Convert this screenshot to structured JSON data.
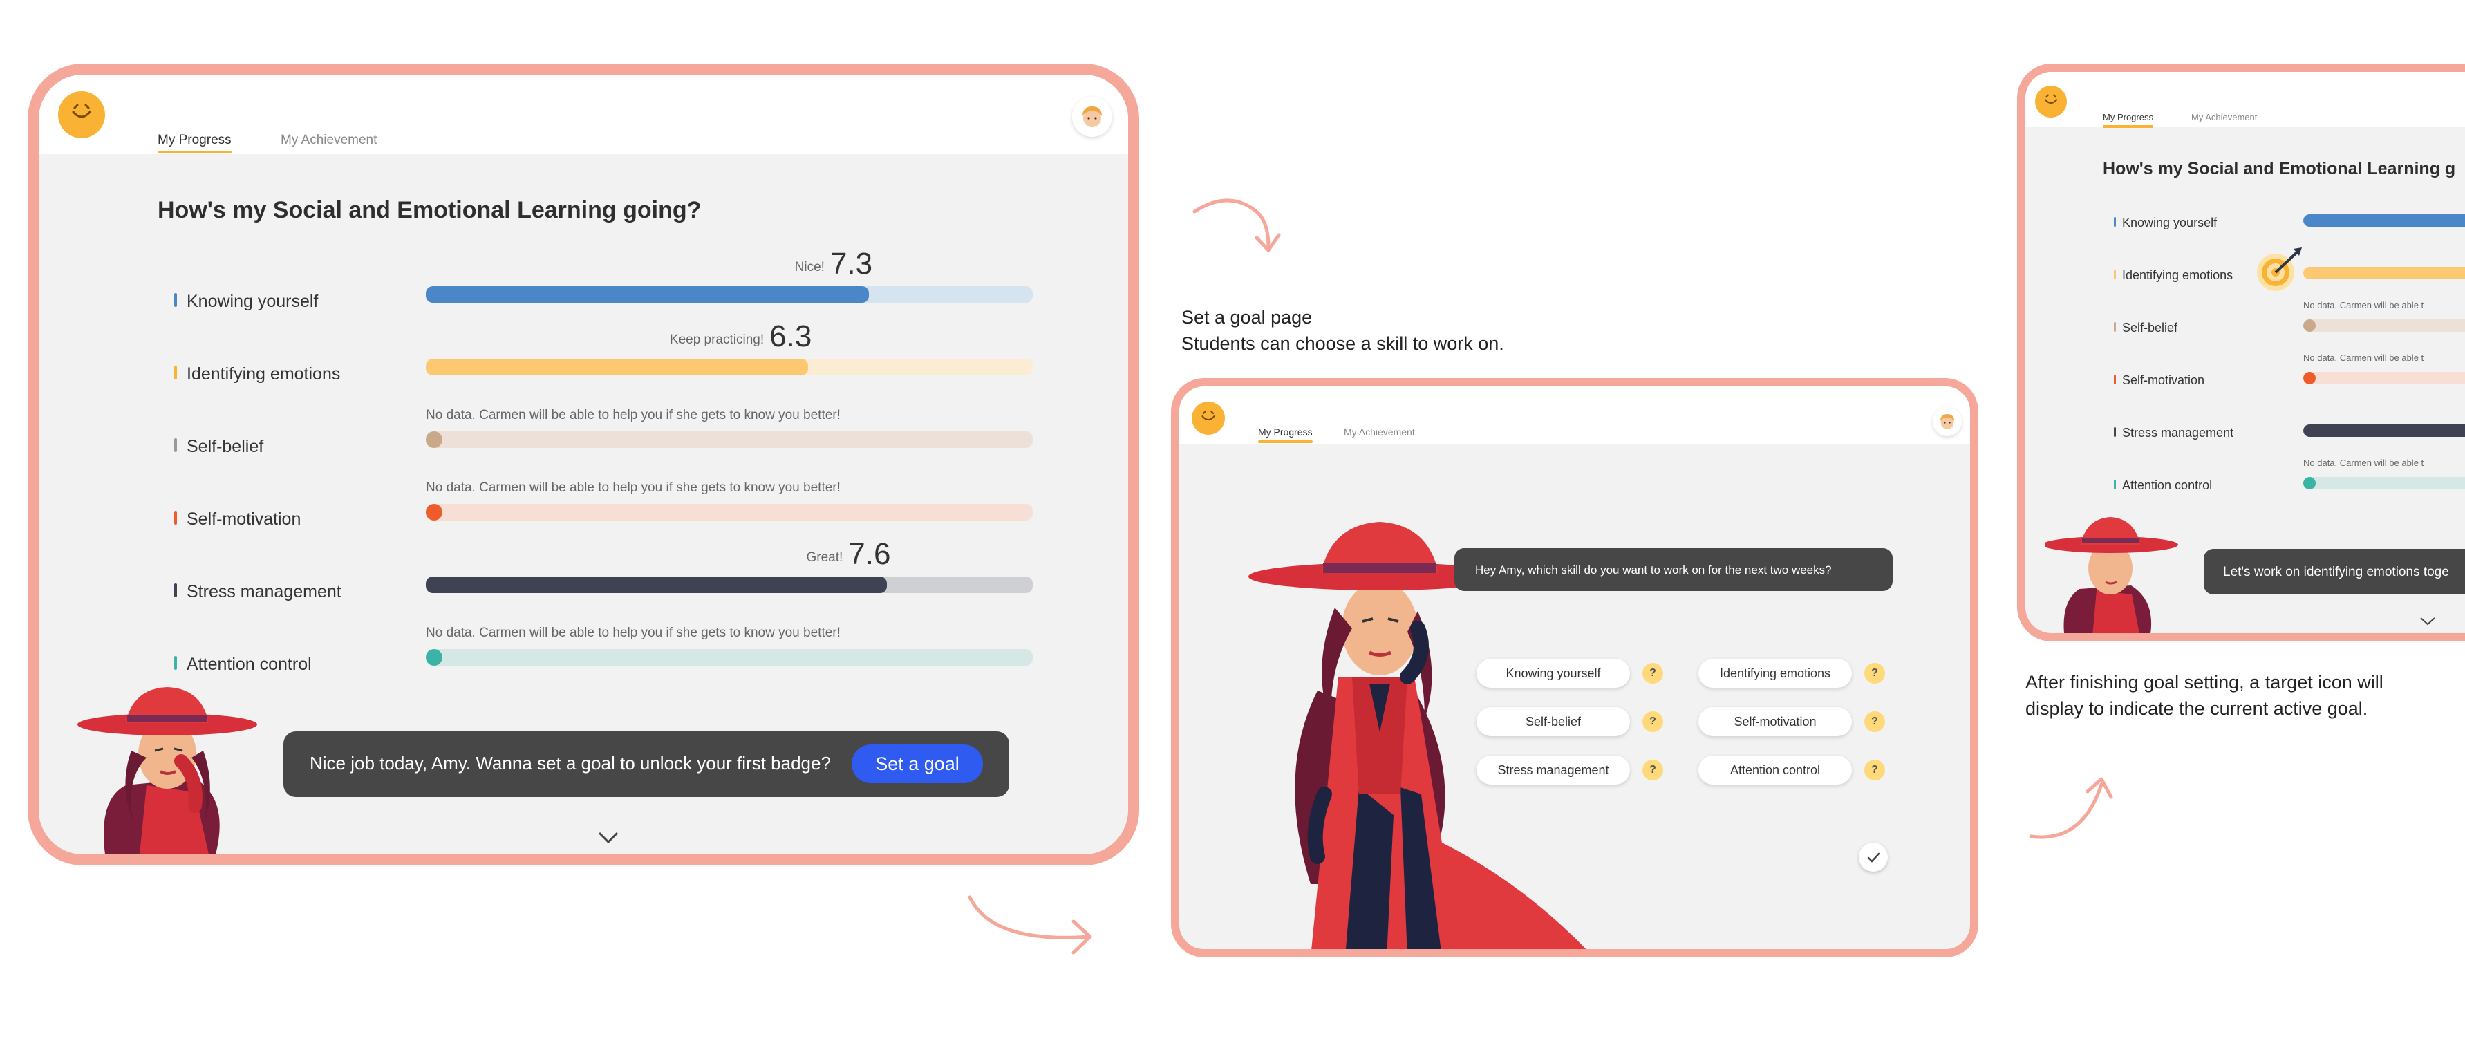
{
  "colors": {
    "frame_border": "#f5a79a",
    "primary_blue": "#2f5bf0",
    "brand_yellow": "#f9b233",
    "dark_bubble": "#474747"
  },
  "screen1": {
    "tabs": [
      "My Progress",
      "My Achievement"
    ],
    "active_tab": "My Progress",
    "title": "How's my Social and Emotional Learning going?",
    "skills": [
      {
        "label": "Knowing yourself",
        "word": "Nice!",
        "score": "7.3",
        "value": 7.3,
        "nodata": "",
        "color": "#4a86c8",
        "track": "#d6e4ef",
        "marker": "#4a86c8"
      },
      {
        "label": "Identifying emotions",
        "word": "Keep practicing!",
        "score": "6.3",
        "value": 6.3,
        "nodata": "",
        "color": "#fdc872",
        "track": "#fbecd3",
        "marker": "#f9b233"
      },
      {
        "label": "Self-belief",
        "word": "",
        "score": "",
        "value": null,
        "nodata": "No data. Carmen will be able to help you if she gets to know you better!",
        "color": "#c9a98a",
        "track": "#ede0d8",
        "marker": "#999"
      },
      {
        "label": "Self-motivation",
        "word": "",
        "score": "",
        "value": null,
        "nodata": "No data. Carmen will be able to help you if she gets to know you better!",
        "color": "#ef5c2b",
        "track": "#f7dfd6",
        "marker": "#ef5c2b"
      },
      {
        "label": "Stress management",
        "word": "Great!",
        "score": "7.6",
        "value": 7.6,
        "nodata": "",
        "color": "#3e4252",
        "track": "#cfd0d4",
        "marker": "#3e4252"
      },
      {
        "label": "Attention control",
        "word": "",
        "score": "",
        "value": null,
        "nodata": "No data. Carmen will be able to help you if she gets to know you better!",
        "color": "#3cb4a5",
        "track": "#d5e8e6",
        "marker": "#3cb4a5"
      }
    ],
    "bubble_text": "Nice job today, Amy. Wanna set a goal to unlock your first badge?",
    "cta_label": "Set a goal"
  },
  "screen2": {
    "caption_title": "Set a goal page",
    "caption_body": "Students can choose a skill to work on.",
    "tabs": [
      "My Progress",
      "My Achievement"
    ],
    "question": "Hey Amy, which skill do you want to work on for the next two weeks?",
    "chips": [
      "Knowing yourself",
      "Identifying emotions",
      "Self-belief",
      "Self-motivation",
      "Stress management",
      "Attention control"
    ],
    "qmark": "?"
  },
  "screen3": {
    "tabs": [
      "My Progress",
      "My Achievement"
    ],
    "title": "How's my Social and Emotional Learning g",
    "skills": [
      "Knowing yourself",
      "Identifying emotions",
      "Self-belief",
      "Self-motivation",
      "Stress management",
      "Attention control"
    ],
    "nodata_partial": "No data. Carmen will be able t",
    "bubble_text": "Let's work on identifying emotions toge",
    "caption": "After finishing goal setting,  a target icon will display to indicate the current active goal."
  }
}
